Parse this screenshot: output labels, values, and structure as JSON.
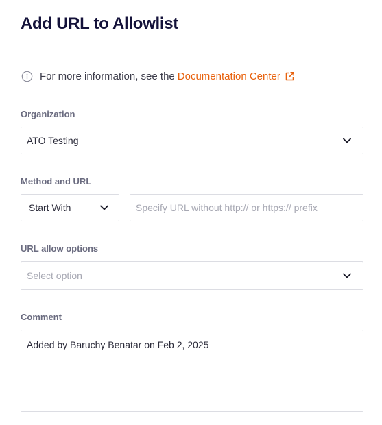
{
  "page": {
    "title": "Add URL to Allowlist"
  },
  "info": {
    "icon": "info-icon",
    "text": "For more information, see the",
    "link_label": "Documentation Center",
    "link_icon": "external-link-icon",
    "link_color": "#e8620e"
  },
  "organization": {
    "label": "Organization",
    "value": "ATO Testing"
  },
  "method_url": {
    "label": "Method and URL",
    "method_value": "Start With",
    "url_placeholder": "Specify URL without http:// or https:// prefix",
    "url_value": ""
  },
  "allow_options": {
    "label": "URL allow options",
    "placeholder": "Select option"
  },
  "comment": {
    "label": "Comment",
    "value": "Added by Baruchy Benatar on Feb 2, 2025"
  }
}
